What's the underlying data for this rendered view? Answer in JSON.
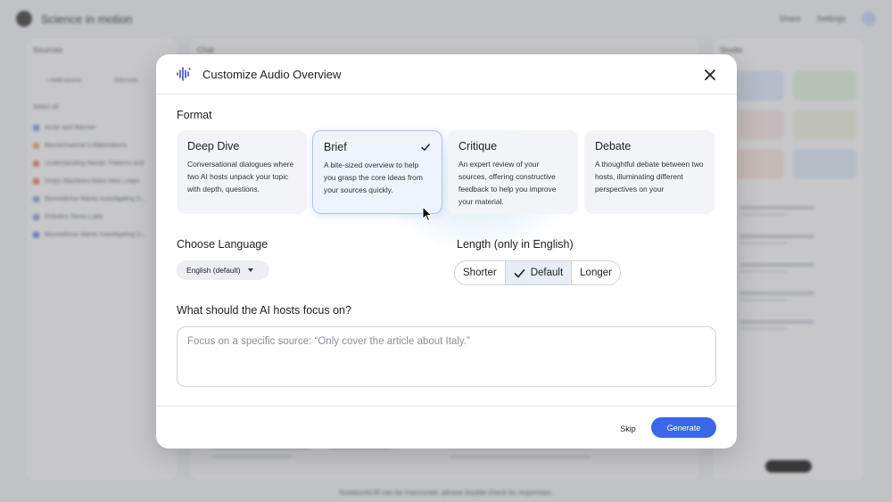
{
  "app": {
    "title": "Science in motion",
    "header_actions": [
      "Share",
      "Settings"
    ],
    "sources_title": "Sources",
    "add_source": "+ Add source",
    "discover": "Discover",
    "select_all": "Select all",
    "sources": [
      {
        "name": "Arctic and Warmer",
        "color": "#7aa0ea"
      },
      {
        "name": "Biomechanical Collaborations",
        "color": "#f1a65a"
      },
      {
        "name": "Understanding Needs: Patterns and",
        "color": "#ef7d6b"
      },
      {
        "name": "Drops Machines Make New Leaps",
        "color": "#ef7d6b"
      },
      {
        "name": "Biomedicine Wants Investigating D...",
        "color": "#8a9ce8"
      },
      {
        "name": "Robotics Terms Labs",
        "color": "#8a9ce8"
      },
      {
        "name": "Biomedicine Wants Investigating D...",
        "color": "#6b8de8"
      }
    ],
    "chat_title": "Chat",
    "studio_title": "Studio",
    "studio_cards": [
      {
        "color": "#dfe6f8"
      },
      {
        "color": "#dff1df"
      },
      {
        "color": "#f3e5e5"
      },
      {
        "color": "#ecefe0"
      },
      {
        "color": "#f5e4df"
      },
      {
        "color": "#dce9f5"
      }
    ],
    "footer_note": "NotebookLM can be inaccurate, please double check its responses."
  },
  "modal": {
    "title": "Customize Audio Overview",
    "format_label": "Format",
    "formats": [
      {
        "name": "Deep Dive",
        "desc": "Conversational dialogues where two AI hosts unpack your topic with depth, questions.",
        "selected": false
      },
      {
        "name": "Brief",
        "desc": "A bite-sized overview to help you grasp the core ideas from your sources quickly.",
        "selected": true
      },
      {
        "name": "Critique",
        "desc": "An expert review of your sources, offering constructive feedback to help you improve your material.",
        "selected": false
      },
      {
        "name": "Debate",
        "desc": "A thoughtful debate between two hosts, illuminating different perspectives on your",
        "selected": false
      }
    ],
    "language_label": "Choose Language",
    "language_value": "English (default)",
    "length_label": "Length (only in English)",
    "length_options": [
      "Shorter",
      "Default",
      "Longer"
    ],
    "length_selected": "Default",
    "focus_label": "What should the AI hosts focus on?",
    "focus_placeholder": "Focus on a specific source: “Only cover the article about Italy.”",
    "skip_label": "Skip",
    "generate_label": "Generate",
    "accent_color": "#3a67e8"
  }
}
